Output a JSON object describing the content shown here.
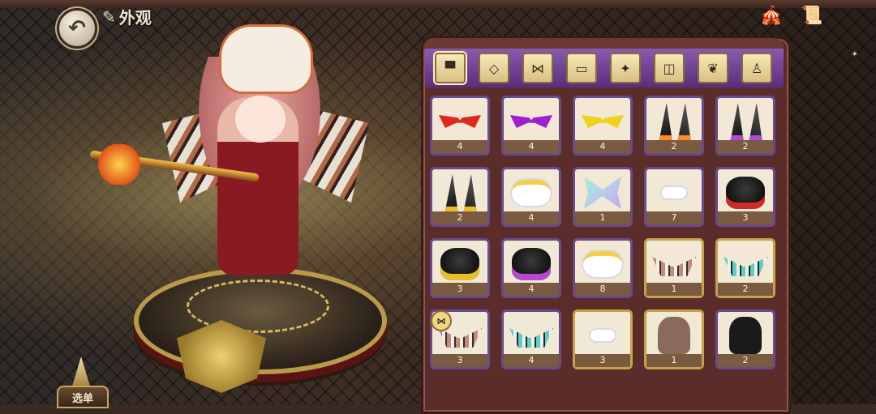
{
  "header": {
    "title": "外观",
    "title_icon": "quill-icon",
    "back_icon": "back-arrow-icon"
  },
  "top_right": [
    {
      "name": "carousel-tent-icon",
      "glyph": "🎪"
    },
    {
      "name": "notebook-quill-icon",
      "glyph": "📜"
    }
  ],
  "menu_button": {
    "label": "选单"
  },
  "tabs": [
    {
      "name": "tab-hat",
      "glyph": "▀",
      "active": true
    },
    {
      "name": "tab-mask",
      "glyph": "◇",
      "active": false
    },
    {
      "name": "tab-wings",
      "glyph": "⋈",
      "active": false
    },
    {
      "name": "tab-belt",
      "glyph": "▭",
      "active": false
    },
    {
      "name": "tab-effects",
      "glyph": "✦",
      "active": false
    },
    {
      "name": "tab-frame",
      "glyph": "◫",
      "active": false
    },
    {
      "name": "tab-emblem",
      "glyph": "❦",
      "active": false
    },
    {
      "name": "tab-pose",
      "glyph": "♙",
      "active": false
    }
  ],
  "items": [
    {
      "kind": "glasses",
      "color": "#e0281e",
      "count": "4",
      "frame": "purple"
    },
    {
      "kind": "glasses",
      "color": "#a01ed0",
      "count": "4",
      "frame": "purple"
    },
    {
      "kind": "glasses",
      "color": "#f0d21e",
      "count": "4",
      "frame": "purple"
    },
    {
      "kind": "horns",
      "color": "#ff8a2a",
      "count": "2",
      "frame": "purple"
    },
    {
      "kind": "horns",
      "color": "#b04ad0",
      "count": "2",
      "frame": "purple"
    },
    {
      "kind": "horns",
      "color": "#e8c02a",
      "count": "2",
      "frame": "purple"
    },
    {
      "kind": "cloud-crown",
      "color": "#f4d04a",
      "count": "4",
      "frame": "purple"
    },
    {
      "kind": "butterfly",
      "color": "#a6f0e0",
      "count": "1",
      "frame": "purple"
    },
    {
      "kind": "cloud",
      "color": "#ffffff",
      "count": "7",
      "frame": "purple"
    },
    {
      "kind": "pot",
      "color": "#d02a2a",
      "count": "3",
      "frame": "purple"
    },
    {
      "kind": "pot",
      "color": "#e8c02a",
      "count": "3",
      "frame": "purple"
    },
    {
      "kind": "pot",
      "color": "#b84ad0",
      "count": "4",
      "frame": "purple"
    },
    {
      "kind": "cloud-crown",
      "color": "#f4d04a",
      "count": "8",
      "frame": "purple"
    },
    {
      "kind": "wings",
      "color": "#c58a7a",
      "count": "1",
      "frame": "gold"
    },
    {
      "kind": "wings-teal",
      "color": "#5ad0c8",
      "count": "2",
      "frame": "gold"
    },
    {
      "kind": "wings",
      "color": "#c58a7a",
      "count": "3",
      "frame": "purple",
      "badge": true
    },
    {
      "kind": "wings-teal",
      "color": "#5ad0c8",
      "count": "4",
      "frame": "purple"
    },
    {
      "kind": "cloud",
      "color": "#ffffff",
      "count": "3",
      "frame": "gold"
    },
    {
      "kind": "beast",
      "color": "#8a6a5a",
      "count": "1",
      "frame": "gold"
    },
    {
      "kind": "beast",
      "color": "#1a1a1a",
      "count": "2",
      "frame": "purple"
    }
  ]
}
